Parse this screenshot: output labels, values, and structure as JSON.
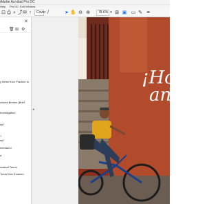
{
  "window": {
    "title": "Adobe Acrobat Pro DC"
  },
  "menubar": {
    "items": [
      "Help",
      "Pro DC",
      "Edit",
      "Window"
    ]
  },
  "toolbar": {
    "cover_label": "Cover",
    "page_current": "",
    "zoom_value": "78.6%",
    "zoom_caret": "▾"
  },
  "sidebar": {
    "close_glyph": "✕",
    "bookmarks": [
      "y Items from Practice to",
      "ciones Breves (Brief",
      "Investigation",
      "ay?",
      "?",
      "ay?",
      "mentario!",
      "a",
      "matical Terms",
      "Toma Este Examen"
    ]
  },
  "document": {
    "hero_line_1": "¡Ho",
    "hero_line_2": "an",
    "colors": {
      "wall": "#8f2f1e",
      "sky": "#f2ece0",
      "shirt": "#e0a51c",
      "jeans": "#2c3d5a"
    }
  }
}
